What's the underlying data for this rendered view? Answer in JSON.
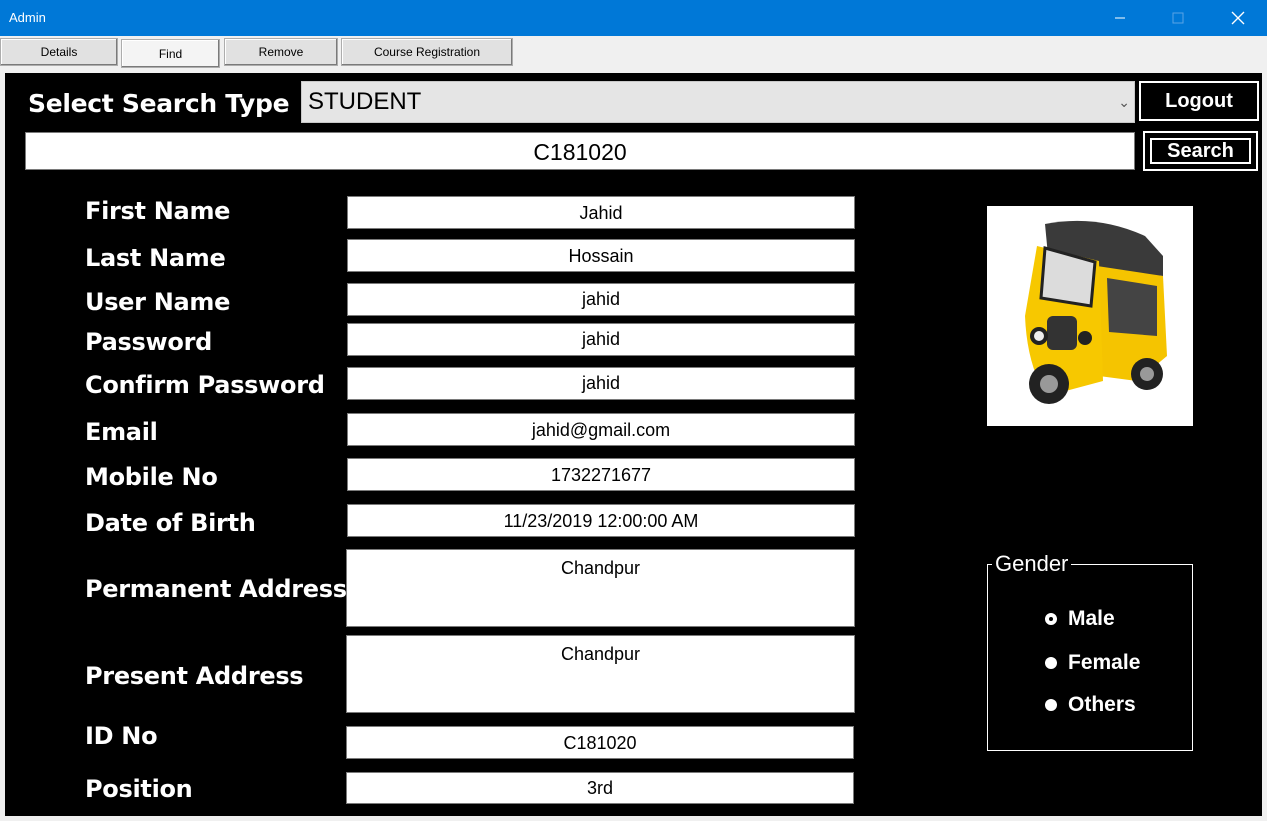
{
  "window": {
    "title": "Admin"
  },
  "tabs": [
    {
      "label": "Details"
    },
    {
      "label": "Find"
    },
    {
      "label": "Remove"
    },
    {
      "label": "Course Registration"
    }
  ],
  "search": {
    "type_label": "Select Search Type",
    "type_value": "STUDENT",
    "query": "C181020",
    "search_button": "Search",
    "logout_button": "Logout"
  },
  "form": {
    "first_name": {
      "label": "First Name",
      "value": "Jahid"
    },
    "last_name": {
      "label": "Last Name",
      "value": "Hossain"
    },
    "user_name": {
      "label": "User Name",
      "value": "jahid"
    },
    "password": {
      "label": "Password",
      "value": "jahid"
    },
    "confirm_password": {
      "label": "Confirm Password",
      "value": "jahid"
    },
    "email": {
      "label": "Email",
      "value": "jahid@gmail.com"
    },
    "mobile": {
      "label": "Mobile No",
      "value": "1732271677"
    },
    "dob": {
      "label": "Date of Birth",
      "value": "11/23/2019 12:00:00 AM"
    },
    "permanent_address": {
      "label": "Permanent Address",
      "value": "Chandpur"
    },
    "present_address": {
      "label": "Present Address",
      "value": "Chandpur"
    },
    "id_no": {
      "label": "ID No",
      "value": "C181020"
    },
    "position": {
      "label": "Position",
      "value": "3rd"
    }
  },
  "gender": {
    "legend": "Gender",
    "options": [
      "Male",
      "Female",
      "Others"
    ],
    "selected": "Male"
  },
  "colors": {
    "titlebar": "#0078d7",
    "panel": "#000000"
  }
}
